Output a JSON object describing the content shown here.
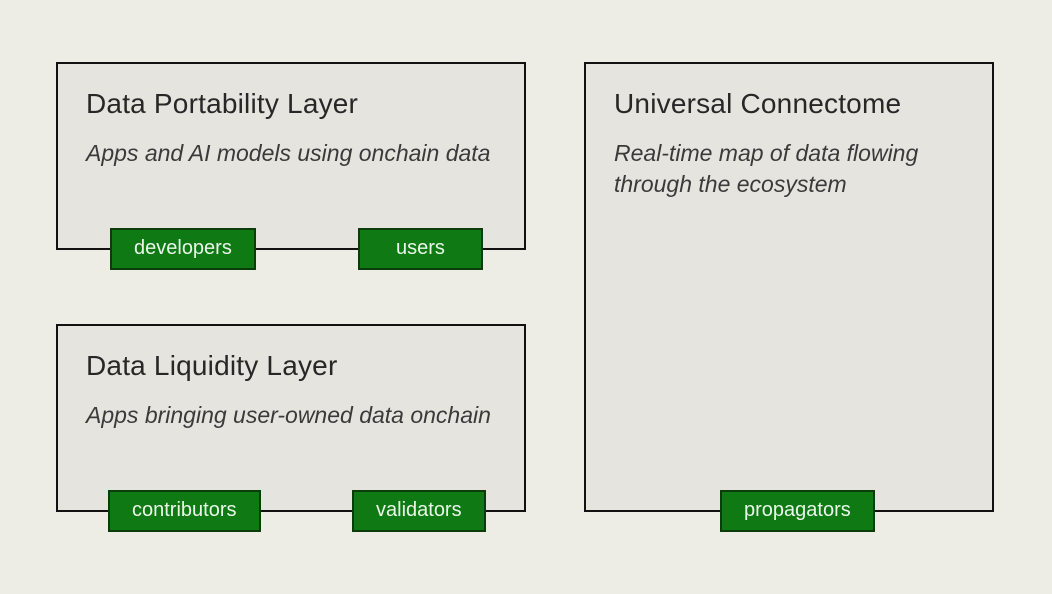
{
  "left_top": {
    "title": "Data Portability Layer",
    "desc": "Apps and AI models using onchain data",
    "tags": [
      "developers",
      "users"
    ]
  },
  "left_bottom": {
    "title": "Data Liquidity Layer",
    "desc": "Apps bringing user-owned data onchain",
    "tags": [
      "contributors",
      "validators"
    ]
  },
  "right": {
    "title": "Universal Connectome",
    "desc": "Real-time map of data flowing through the ecosystem",
    "tags": [
      "propagators"
    ]
  }
}
